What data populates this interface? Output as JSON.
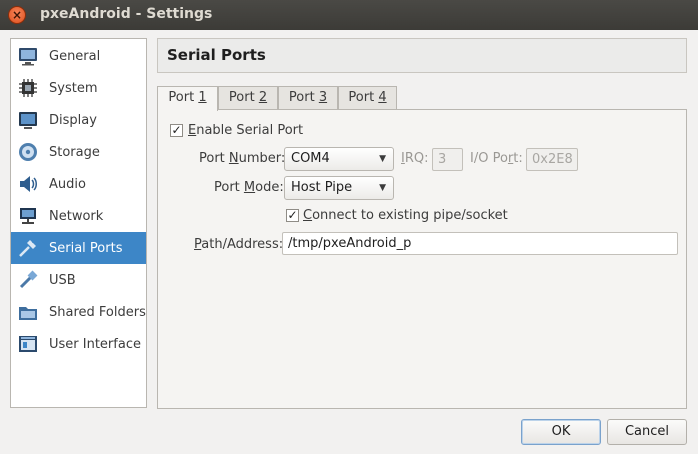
{
  "window": {
    "title": "pxeAndroid - Settings",
    "close_glyph": "×"
  },
  "sidebar": {
    "items": [
      {
        "label": "General",
        "icon": "monitor-icon"
      },
      {
        "label": "System",
        "icon": "chip-icon"
      },
      {
        "label": "Display",
        "icon": "display-icon"
      },
      {
        "label": "Storage",
        "icon": "storage-icon"
      },
      {
        "label": "Audio",
        "icon": "audio-icon"
      },
      {
        "label": "Network",
        "icon": "network-icon"
      },
      {
        "label": "Serial Ports",
        "icon": "serial-port-icon"
      },
      {
        "label": "USB",
        "icon": "usb-icon"
      },
      {
        "label": "Shared Folders",
        "icon": "shared-folder-icon"
      },
      {
        "label": "User Interface",
        "icon": "user-interface-icon"
      }
    ],
    "active_index": 6
  },
  "header": {
    "title": "Serial Ports"
  },
  "tabs": [
    {
      "pre": "Port ",
      "ul": "1"
    },
    {
      "pre": "Port ",
      "ul": "2"
    },
    {
      "pre": "Port ",
      "ul": "3"
    },
    {
      "pre": "Port ",
      "ul": "4"
    }
  ],
  "form": {
    "enable": {
      "ul": "E",
      "rest": "nable Serial Port",
      "checked": true
    },
    "port_number": {
      "pre": "Port ",
      "ul": "N",
      "rest": "umber:",
      "value": "COM4"
    },
    "irq": {
      "ul": "I",
      "rest": "RQ:",
      "value": "3"
    },
    "io_port": {
      "pre": "I/O Po",
      "ul": "r",
      "rest": "t:",
      "value": "0x2E8"
    },
    "port_mode": {
      "pre": "Port ",
      "ul": "M",
      "rest": "ode:",
      "value": "Host Pipe"
    },
    "connect": {
      "ul": "C",
      "rest": "onnect to existing pipe/socket",
      "checked": true
    },
    "path": {
      "ul": "P",
      "rest": "ath/Address:",
      "value": "/tmp/pxeAndroid_p"
    }
  },
  "buttons": {
    "ok": "OK",
    "cancel": "Cancel"
  },
  "colors": {
    "accent": "#3d86c7",
    "titlebar": "#3c3b37",
    "close": "#dc4e1c"
  }
}
